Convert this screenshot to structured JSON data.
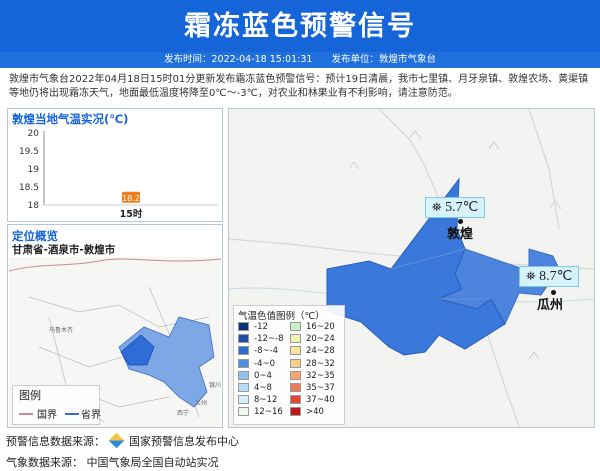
{
  "header": {
    "title": "霜冻蓝色预警信号"
  },
  "subbar": {
    "time": "发布时间：2022-04-18 15:01:31",
    "unit": "发布单位：敦煌市气象台"
  },
  "description": "敦煌市气象台2022年04月18日15时01分更新发布霜冻蓝色预警信号：预计19日清晨，我市七里镇、月牙泉镇、敦煌农场、黄渠镇等地仍将出现霜冻天气，地面最低温度将降至0℃～-3℃，对农业和林果业有不利影响，请注意防范。",
  "temp_panel": {
    "title": "敦煌当地气温实况(℃)",
    "y_ticks": [
      "20",
      "19.5",
      "19",
      "18.5",
      "18"
    ],
    "point_label": "18.2",
    "x_label": "15时"
  },
  "chart_data": {
    "type": "scatter",
    "title": "敦煌当地气温实况(℃)",
    "x": [
      "15时"
    ],
    "values": [
      18.2
    ],
    "ylim": [
      18,
      20
    ]
  },
  "location_panel": {
    "title": "定位概览",
    "path": "甘肃省-酒泉市-敦煌市",
    "legend_title": "图例",
    "legend_country": "国界",
    "legend_province": "省界",
    "place_labels": [
      "乌鲁木齐",
      "西宁",
      "兰州",
      "银川"
    ]
  },
  "map": {
    "cities": [
      {
        "name": "敦煌",
        "temp": "5.7℃"
      },
      {
        "name": "瓜州",
        "temp": "8.7℃"
      }
    ],
    "legend_title": "气温色值图例（℃）",
    "legend_items": [
      {
        "label": "-12",
        "color": "#0b2e7a"
      },
      {
        "label": "-12~-8",
        "color": "#1c4ea6"
      },
      {
        "label": "-8~-4",
        "color": "#2d6cc8"
      },
      {
        "label": "-4~0",
        "color": "#4a8fe0"
      },
      {
        "label": "0~4",
        "color": "#8fc2f0"
      },
      {
        "label": "4~8",
        "color": "#b7dcf7"
      },
      {
        "label": "8~12",
        "color": "#d8eefb"
      },
      {
        "label": "12~16",
        "color": "#eef8ee"
      },
      {
        "label": "16~20",
        "color": "#c8f0c8"
      },
      {
        "label": "20~24",
        "color": "#f1f5b0"
      },
      {
        "label": "24~28",
        "color": "#fbe59a"
      },
      {
        "label": "28~32",
        "color": "#fbd08a"
      },
      {
        "label": "32~35",
        "color": "#f7a66e"
      },
      {
        "label": "35~37",
        "color": "#ef7a5b"
      },
      {
        "label": "37~40",
        "color": "#e0463a"
      },
      {
        "label": ">40",
        "color": "#c01818"
      }
    ]
  },
  "footer": {
    "source1_label": "预警信息数据来源：",
    "source1_value": "国家预警信息发布中心",
    "source2_label": "气象数据来源：",
    "source2_value": "中国气象局全国自动站实况"
  }
}
